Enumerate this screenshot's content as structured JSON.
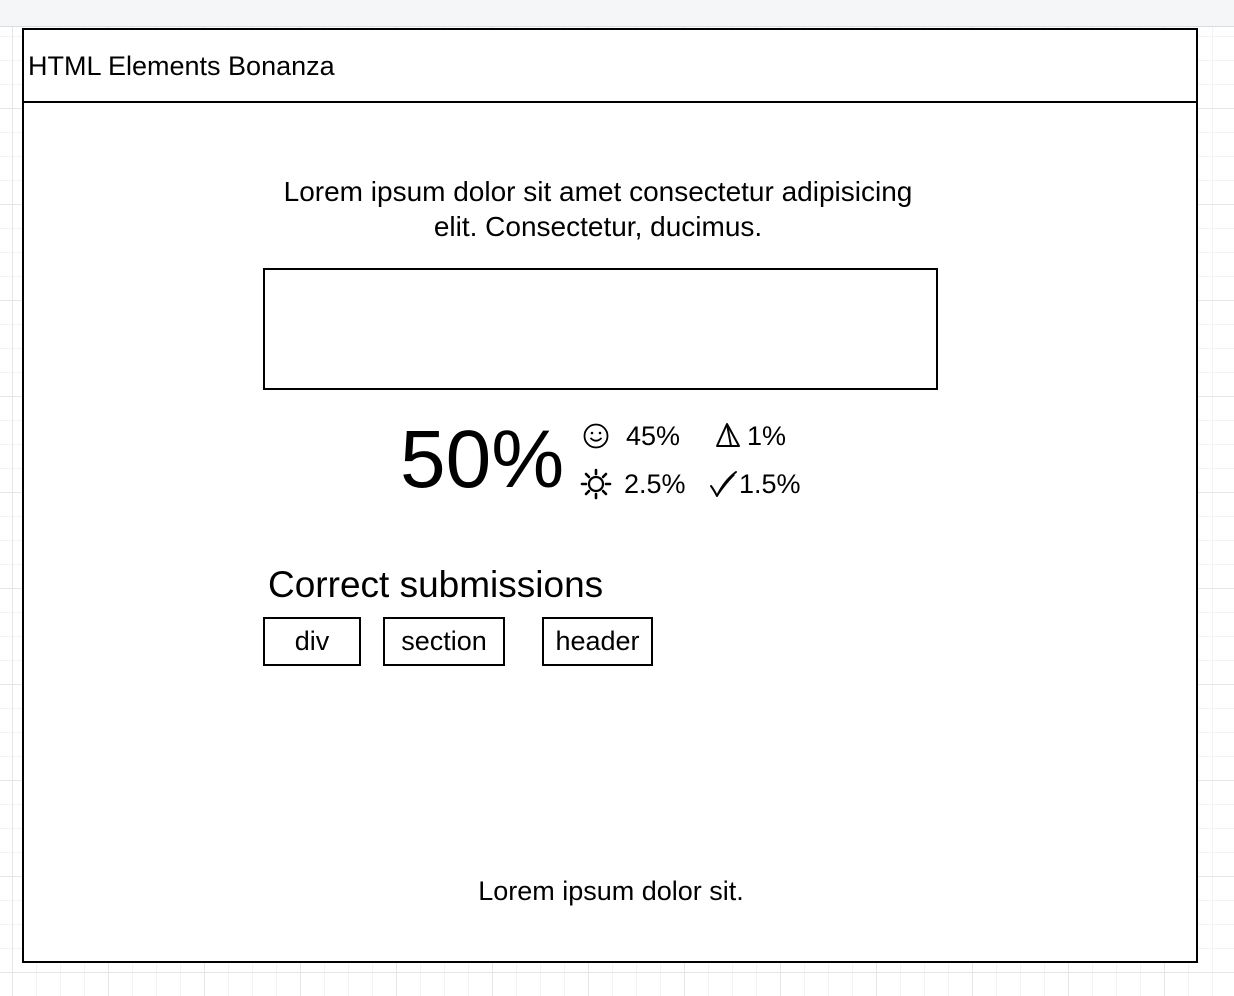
{
  "app": {
    "title": "HTML Elements Bonanza"
  },
  "intro": {
    "text": "Lorem ipsum dolor sit amet consectetur adipisicing elit. Consectetur, ducimus."
  },
  "answer_box": {
    "value": ""
  },
  "stats": {
    "main_percent": "50%",
    "items": [
      {
        "icon": "smiley-icon",
        "value": "45%"
      },
      {
        "icon": "pyramid-icon",
        "value": "1%"
      },
      {
        "icon": "sun-icon",
        "value": "2.5%"
      },
      {
        "icon": "quill-check-icon",
        "value": "1.5%"
      }
    ]
  },
  "submissions": {
    "heading": "Correct submissions",
    "tags": [
      "div",
      "section",
      "header"
    ]
  },
  "footer": {
    "text": "Lorem ipsum dolor sit."
  },
  "colors": {
    "ink": "#000000",
    "canvas": "#ffffff",
    "grid": "#e6e6e6"
  }
}
